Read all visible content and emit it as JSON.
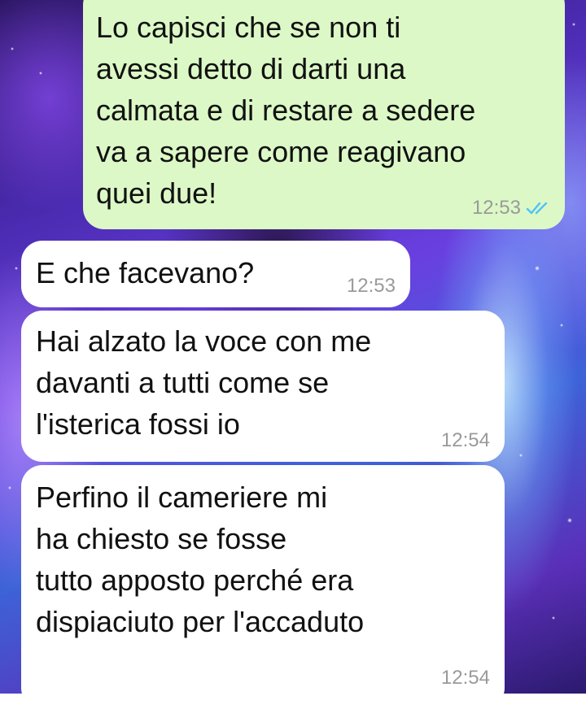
{
  "chat": {
    "messages": [
      {
        "id": "m1",
        "direction": "outgoing",
        "text": "Lo capisci che se non ti\navessi detto di darti una\ncalmata e di restare a sedere\nva a sapere come reagivano\nquei due!",
        "time": "12:53",
        "status_icon": "double-check-icon",
        "status_color": "#4fc3f7"
      },
      {
        "id": "m2",
        "direction": "incoming",
        "text": "E che facevano?",
        "time": "12:53"
      },
      {
        "id": "m3",
        "direction": "incoming",
        "text": "Hai alzato la voce con me\ndavanti a tutti come se\nl'isterica fossi io",
        "time": "12:54"
      },
      {
        "id": "m4",
        "direction": "incoming",
        "text": "Perfino il cameriere mi\nha chiesto se fosse\ntutto apposto perché era\ndispiaciuto per l'accaduto",
        "time": "12:54"
      }
    ]
  },
  "theme": {
    "outgoing_bubble": "#dcf8c6",
    "incoming_bubble": "#ffffff",
    "timestamp_color": "#9a9a9a"
  }
}
